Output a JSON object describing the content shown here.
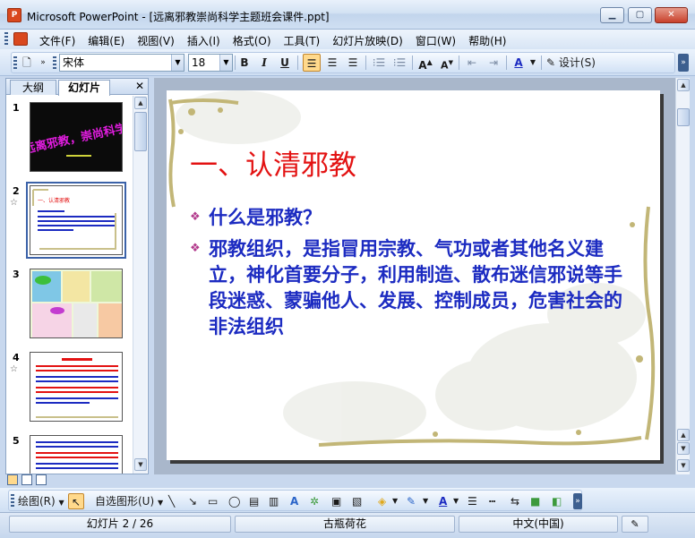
{
  "window": {
    "title": "Microsoft PowerPoint - [远离邪教崇尚科学主题班会课件.ppt]",
    "icon": "powerpoint-icon"
  },
  "menu": {
    "items": [
      "文件(F)",
      "编辑(E)",
      "视图(V)",
      "插入(I)",
      "格式(O)",
      "工具(T)",
      "幻灯片放映(D)",
      "窗口(W)",
      "帮助(H)"
    ]
  },
  "toolbar": {
    "font_name": "宋体",
    "font_size": "18",
    "bold": "B",
    "italic": "I",
    "underline": "U",
    "design_label": "设计(S)"
  },
  "left_panel": {
    "tabs": [
      "大纲",
      "幻灯片"
    ],
    "close": "✕",
    "thumbnails": [
      {
        "number": "1",
        "star": "",
        "selected": false,
        "title": "远离邪教，崇尚科学"
      },
      {
        "number": "2",
        "star": "☆",
        "selected": true,
        "title": "一、认清邪教"
      },
      {
        "number": "3",
        "star": "",
        "selected": false,
        "title": ""
      },
      {
        "number": "4",
        "star": "☆",
        "selected": false,
        "title": ""
      },
      {
        "number": "5",
        "star": "",
        "selected": false,
        "title": ""
      }
    ]
  },
  "slide": {
    "title": "一、认清邪教",
    "bullets": [
      "什么是邪教？",
      "邪教组织，是指冒用宗教、气功或者其他名义建立，神化首要分子，利用制造、散布迷信邪说等手段迷惑、蒙骗他人、发展、控制成员，危害社会的非法组织"
    ],
    "bullet_symbol": "❖"
  },
  "draw_toolbar": {
    "draw_label": "绘图(R)",
    "autoshape_label": "自选图形(U)"
  },
  "status": {
    "slide_position": "幻灯片 2 / 26",
    "design_template": "古瓶荷花",
    "language": "中文(中国)"
  }
}
